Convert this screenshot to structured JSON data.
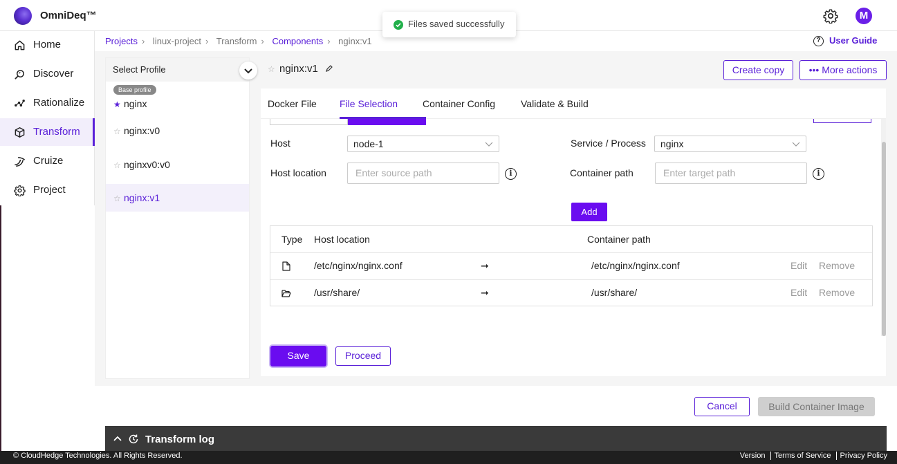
{
  "app": {
    "brand": "OmniDeq™",
    "avatar_initial": "M"
  },
  "toast": {
    "message": "Files saved successfully"
  },
  "sidebar": {
    "items": [
      {
        "label": "Home",
        "icon": "home-icon"
      },
      {
        "label": "Discover",
        "icon": "discover-icon"
      },
      {
        "label": "Rationalize",
        "icon": "rationalize-icon"
      },
      {
        "label": "Transform",
        "icon": "transform-icon",
        "active": true
      },
      {
        "label": "Cruize",
        "icon": "cruize-icon"
      },
      {
        "label": "Project",
        "icon": "project-gear-icon"
      }
    ]
  },
  "breadcrumb": [
    "Projects",
    "linux-project",
    "Transform",
    "Components",
    "nginx:v1"
  ],
  "user_guide": "User Guide",
  "profile": {
    "header": "Select Profile",
    "base_badge": "Base profile",
    "items": [
      "nginx",
      "nginx:v0",
      "nginxv0:v0",
      "nginx:v1"
    ]
  },
  "component": {
    "title": "nginx:v1"
  },
  "actions": {
    "create_copy": "Create copy",
    "more_actions": "••• More actions"
  },
  "tabs": [
    "Docker File",
    "File Selection",
    "Container Config",
    "Validate & Build"
  ],
  "form": {
    "host_label": "Host",
    "host_value": "node-1",
    "service_label": "Service / Process",
    "service_value": "nginx",
    "host_location_label": "Host location",
    "host_location_placeholder": "Enter source path",
    "container_path_label": "Container path",
    "container_path_placeholder": "Enter target path",
    "add_label": "Add"
  },
  "table": {
    "headers": [
      "Type",
      "Host location",
      "Container path"
    ],
    "rows": [
      {
        "type": "file",
        "host": "/etc/nginx/nginx.conf",
        "container": "/etc/nginx/nginx.conf",
        "edit": "Edit",
        "remove": "Remove"
      },
      {
        "type": "folder",
        "host": "/usr/share/",
        "container": "/usr/share/",
        "edit": "Edit",
        "remove": "Remove"
      }
    ]
  },
  "buttons": {
    "save": "Save",
    "proceed": "Proceed",
    "cancel": "Cancel",
    "build": "Build Container Image"
  },
  "log": {
    "title": "Transform log"
  },
  "footer": {
    "copyright": "© CloudHedge Technologies. All Rights Reserved.",
    "links": [
      "Version",
      "Terms of Service",
      "Privacy Policy"
    ]
  },
  "colors": {
    "accent": "#5a20d8",
    "primary_button": "#6a0cf0",
    "success": "#22b04b"
  }
}
